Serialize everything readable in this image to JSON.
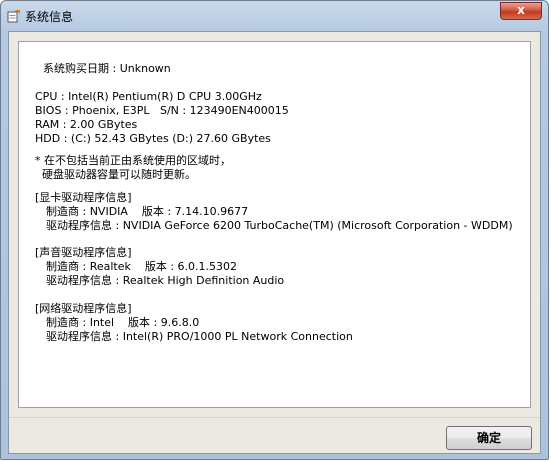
{
  "window": {
    "title": "系统信息",
    "close_label": "x"
  },
  "info": {
    "purchase_date": "系统购买日期 : Unknown",
    "hardware": [
      "CPU : Intel(R) Pentium(R) D CPU 3.00GHz",
      "BIOS : Phoenix, E3PL   S/N : 123490EN400015",
      "RAM : 2.00 GBytes",
      "HDD : (C:) 52.43 GBytes (D:) 27.60 GBytes"
    ],
    "note": [
      "* 在不包括当前正由系统使用的区域时，",
      "  硬盘驱动器容量可以随时更新。"
    ],
    "drivers": [
      {
        "header": "[显卡驱动程序信息]",
        "maker_line": "制造商 : NVIDIA    版本 : 7.14.10.9677",
        "info_line": "驱动程序信息 : NVIDIA GeForce 6200 TurboCache(TM) (Microsoft Corporation - WDDM)"
      },
      {
        "header": "[声音驱动程序信息]",
        "maker_line": "制造商 : Realtek    版本 : 6.0.1.5302",
        "info_line": "驱动程序信息 : Realtek High Definition Audio"
      },
      {
        "header": "[网络驱动程序信息]",
        "maker_line": "制造商 : Intel    版本 : 9.6.8.0",
        "info_line": "驱动程序信息 : Intel(R) PRO/1000 PL Network Connection"
      }
    ]
  },
  "buttons": {
    "ok_label": "确定"
  }
}
